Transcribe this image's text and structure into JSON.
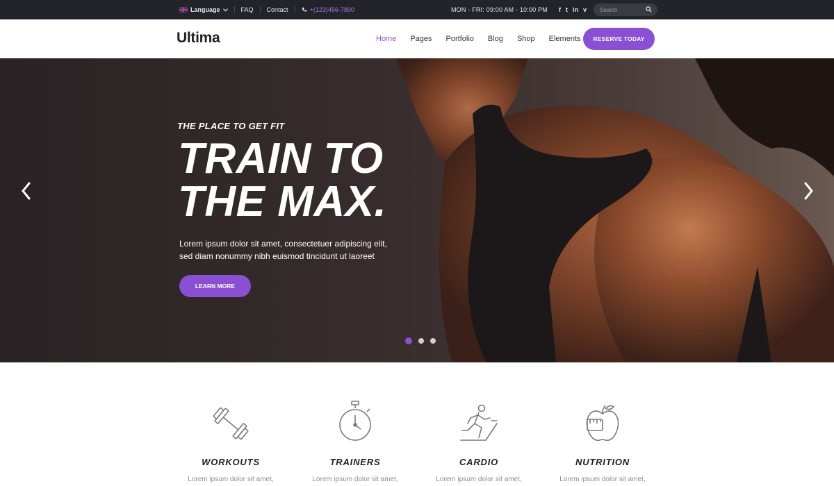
{
  "topbar": {
    "language": "Language",
    "faq": "FAQ",
    "contact": "Contact",
    "phone": "+(123)456-7890",
    "hours": "MON - FRI: 09:00 AM - 10:00 PM",
    "social": [
      "f",
      "t",
      "in",
      "v"
    ],
    "search_placeholder": "Search"
  },
  "header": {
    "logo": "Ultima",
    "nav": [
      "Home",
      "Pages",
      "Portfolio",
      "Blog",
      "Shop",
      "Elements"
    ],
    "active_nav": "Home",
    "cta": "RESERVE TODAY"
  },
  "hero": {
    "eyebrow": "THE PLACE TO GET FIT",
    "headline_line1": "TRAIN TO",
    "headline_line2": "THE MAX.",
    "lede_line1": "Lorem ipsum dolor sit amet, consectetuer adipiscing elit,",
    "lede_line2": "sed diam nonummy nibh euismod tincidunt ut laoreet",
    "button": "LEARN MORE",
    "slide_count": 3,
    "active_slide": 1
  },
  "features": [
    {
      "title": "WORKOUTS",
      "text": "Lorem ipsum dolor sit amet,",
      "icon": "dumbbell-icon"
    },
    {
      "title": "TRAINERS",
      "text": "Lorem ipsum dolor sit amet,",
      "icon": "stopwatch-icon"
    },
    {
      "title": "CARDIO",
      "text": "Lorem ipsum dolor sit amet,",
      "icon": "runner-icon"
    },
    {
      "title": "NUTRITION",
      "text": "Lorem ipsum dolor sit amet,",
      "icon": "apple-icon"
    }
  ],
  "colors": {
    "accent": "#8a4fd3",
    "topbar_bg": "#23242a",
    "hero_bg": "#2e2627"
  }
}
